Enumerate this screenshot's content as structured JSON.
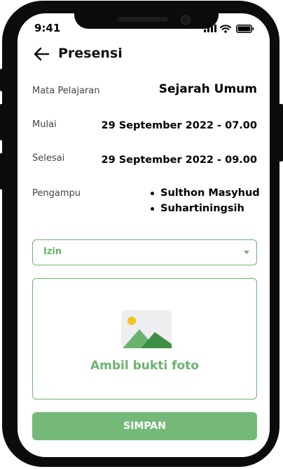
{
  "status_bar": {
    "time": "9:41"
  },
  "header": {
    "title": "Presensi"
  },
  "details": {
    "subject": {
      "label": "Mata Pelajaran",
      "value": "Sejarah Umum"
    },
    "start": {
      "label": "Mulai",
      "value": "29 September 2022 - 07.00"
    },
    "end": {
      "label": "Selesai",
      "value": "29 September 2022 - 09.00"
    },
    "teachers": {
      "label": "Pengampu",
      "names": [
        "Sulthon Masyhud",
        "Suhartiningsih"
      ]
    }
  },
  "attendance_select": {
    "selected": "Izin"
  },
  "photo_upload": {
    "label": "Ambil bukti foto"
  },
  "save_button": {
    "label": "SIMPAN"
  },
  "colors": {
    "accent": "#6cb26f",
    "button": "#74b978",
    "phone_frame": "#0c0c0c"
  }
}
